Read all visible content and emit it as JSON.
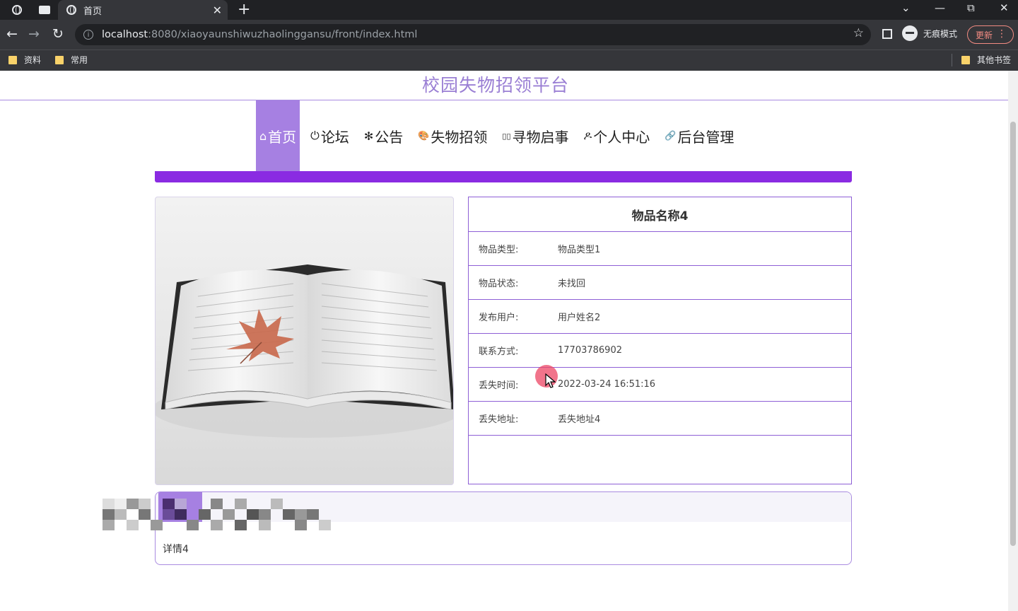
{
  "browser": {
    "tab_title": "首页",
    "url_host": "localhost",
    "url_rest": ":8080/xiaoyaunshiwuzhaolinggansu/front/index.html",
    "incognito_label": "无痕模式",
    "update_label": "更新",
    "bookmarks": [
      "资料",
      "常用"
    ],
    "other_bookmarks": "其他书签"
  },
  "site": {
    "title": "校园失物招领平台",
    "menu": [
      {
        "icon": "⌂",
        "label": "首页"
      },
      {
        "icon": "⏻",
        "label": "论坛"
      },
      {
        "icon": "✻",
        "label": "公告"
      },
      {
        "icon": "🎨",
        "label": "失物招领"
      },
      {
        "icon": "▯▯",
        "label": "寻物启事"
      },
      {
        "icon": "ዶ",
        "label": "个人中心"
      },
      {
        "icon": "🔗",
        "label": "后台管理"
      }
    ]
  },
  "item": {
    "name": "物品名称4",
    "fields": [
      {
        "label": "物品类型:",
        "value": "物品类型1"
      },
      {
        "label": "物品状态:",
        "value": "未找回"
      },
      {
        "label": "发布用户:",
        "value": "用户姓名2"
      },
      {
        "label": "联系方式:",
        "value": "17703786902"
      },
      {
        "label": "丢失时间:",
        "value": "2022-03-24 16:51:16"
      },
      {
        "label": "丢失地址:",
        "value": "丢失地址4"
      }
    ],
    "detail": "详情4"
  },
  "colors": {
    "accent": "#8a2be2",
    "menu_active": "#a680e2",
    "title": "#9a7fd4"
  }
}
